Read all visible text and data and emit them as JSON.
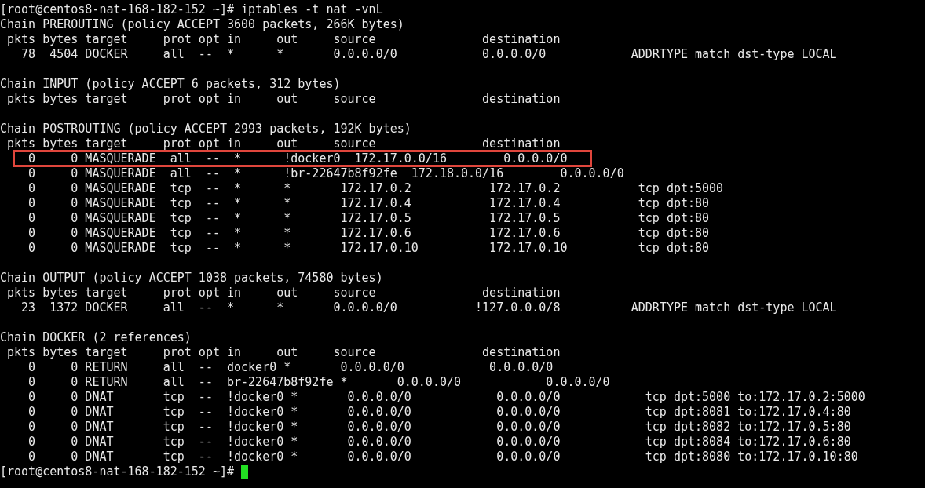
{
  "terminal": {
    "lines": [
      {
        "kind": "command",
        "text": "[root@centos8-nat-168-182-152 ~]# iptables -t nat -vnL"
      },
      {
        "kind": "chain",
        "text": "Chain PREROUTING (policy ACCEPT 3600 packets, 266K bytes)"
      },
      {
        "kind": "header",
        "text": " pkts bytes target     prot opt in     out     source               destination"
      },
      {
        "kind": "rule",
        "highlighted": false,
        "text": "   78  4504 DOCKER     all  --  *      *       0.0.0.0/0            0.0.0.0/0            ADDRTYPE match dst-type LOCAL"
      },
      {
        "kind": "blank"
      },
      {
        "kind": "chain",
        "text": "Chain INPUT (policy ACCEPT 6 packets, 312 bytes)"
      },
      {
        "kind": "header",
        "text": " pkts bytes target     prot opt in     out     source               destination"
      },
      {
        "kind": "blank"
      },
      {
        "kind": "chain",
        "text": "Chain POSTROUTING (policy ACCEPT 2993 packets, 192K bytes)"
      },
      {
        "kind": "header",
        "text": " pkts bytes target     prot opt in     out     source               destination"
      },
      {
        "kind": "rule",
        "highlighted": true,
        "text": "    0     0 MASQUERADE  all  --  *      !docker0  172.17.0.0/16        0.0.0.0/0"
      },
      {
        "kind": "rule",
        "highlighted": false,
        "text": "    0     0 MASQUERADE  all  --  *      !br-22647b8f92fe  172.18.0.0/16        0.0.0.0/0"
      },
      {
        "kind": "rule",
        "highlighted": false,
        "text": "    0     0 MASQUERADE  tcp  --  *      *       172.17.0.2           172.17.0.2           tcp dpt:5000"
      },
      {
        "kind": "rule",
        "highlighted": false,
        "text": "    0     0 MASQUERADE  tcp  --  *      *       172.17.0.4           172.17.0.4           tcp dpt:80"
      },
      {
        "kind": "rule",
        "highlighted": false,
        "text": "    0     0 MASQUERADE  tcp  --  *      *       172.17.0.5           172.17.0.5           tcp dpt:80"
      },
      {
        "kind": "rule",
        "highlighted": false,
        "text": "    0     0 MASQUERADE  tcp  --  *      *       172.17.0.6           172.17.0.6           tcp dpt:80"
      },
      {
        "kind": "rule",
        "highlighted": false,
        "text": "    0     0 MASQUERADE  tcp  --  *      *       172.17.0.10          172.17.0.10          tcp dpt:80"
      },
      {
        "kind": "blank"
      },
      {
        "kind": "chain",
        "text": "Chain OUTPUT (policy ACCEPT 1038 packets, 74580 bytes)"
      },
      {
        "kind": "header",
        "text": " pkts bytes target     prot opt in     out     source               destination"
      },
      {
        "kind": "rule",
        "highlighted": false,
        "text": "   23  1372 DOCKER     all  --  *      *       0.0.0.0/0           !127.0.0.0/8          ADDRTYPE match dst-type LOCAL"
      },
      {
        "kind": "blank"
      },
      {
        "kind": "chain",
        "text": "Chain DOCKER (2 references)"
      },
      {
        "kind": "header",
        "text": " pkts bytes target     prot opt in     out     source               destination"
      },
      {
        "kind": "rule",
        "highlighted": false,
        "text": "    0     0 RETURN     all  --  docker0 *       0.0.0.0/0            0.0.0.0/0"
      },
      {
        "kind": "rule",
        "highlighted": false,
        "text": "    0     0 RETURN     all  --  br-22647b8f92fe *       0.0.0.0/0            0.0.0.0/0"
      },
      {
        "kind": "rule",
        "highlighted": false,
        "text": "    0     0 DNAT       tcp  --  !docker0 *       0.0.0.0/0            0.0.0.0/0            tcp dpt:5000 to:172.17.0.2:5000"
      },
      {
        "kind": "rule",
        "highlighted": false,
        "text": "    0     0 DNAT       tcp  --  !docker0 *       0.0.0.0/0            0.0.0.0/0            tcp dpt:8081 to:172.17.0.4:80"
      },
      {
        "kind": "rule",
        "highlighted": false,
        "text": "    0     0 DNAT       tcp  --  !docker0 *       0.0.0.0/0            0.0.0.0/0            tcp dpt:8082 to:172.17.0.5:80"
      },
      {
        "kind": "rule",
        "highlighted": false,
        "text": "    0     0 DNAT       tcp  --  !docker0 *       0.0.0.0/0            0.0.0.0/0            tcp dpt:8084 to:172.17.0.6:80"
      },
      {
        "kind": "rule",
        "highlighted": false,
        "text": "    0     0 DNAT       tcp  --  !docker0 *       0.0.0.0/0            0.0.0.0/0            tcp dpt:8080 to:172.17.0.10:80"
      },
      {
        "kind": "prompt",
        "cursor": true,
        "text": "[root@centos8-nat-168-182-152 ~]#"
      }
    ]
  }
}
